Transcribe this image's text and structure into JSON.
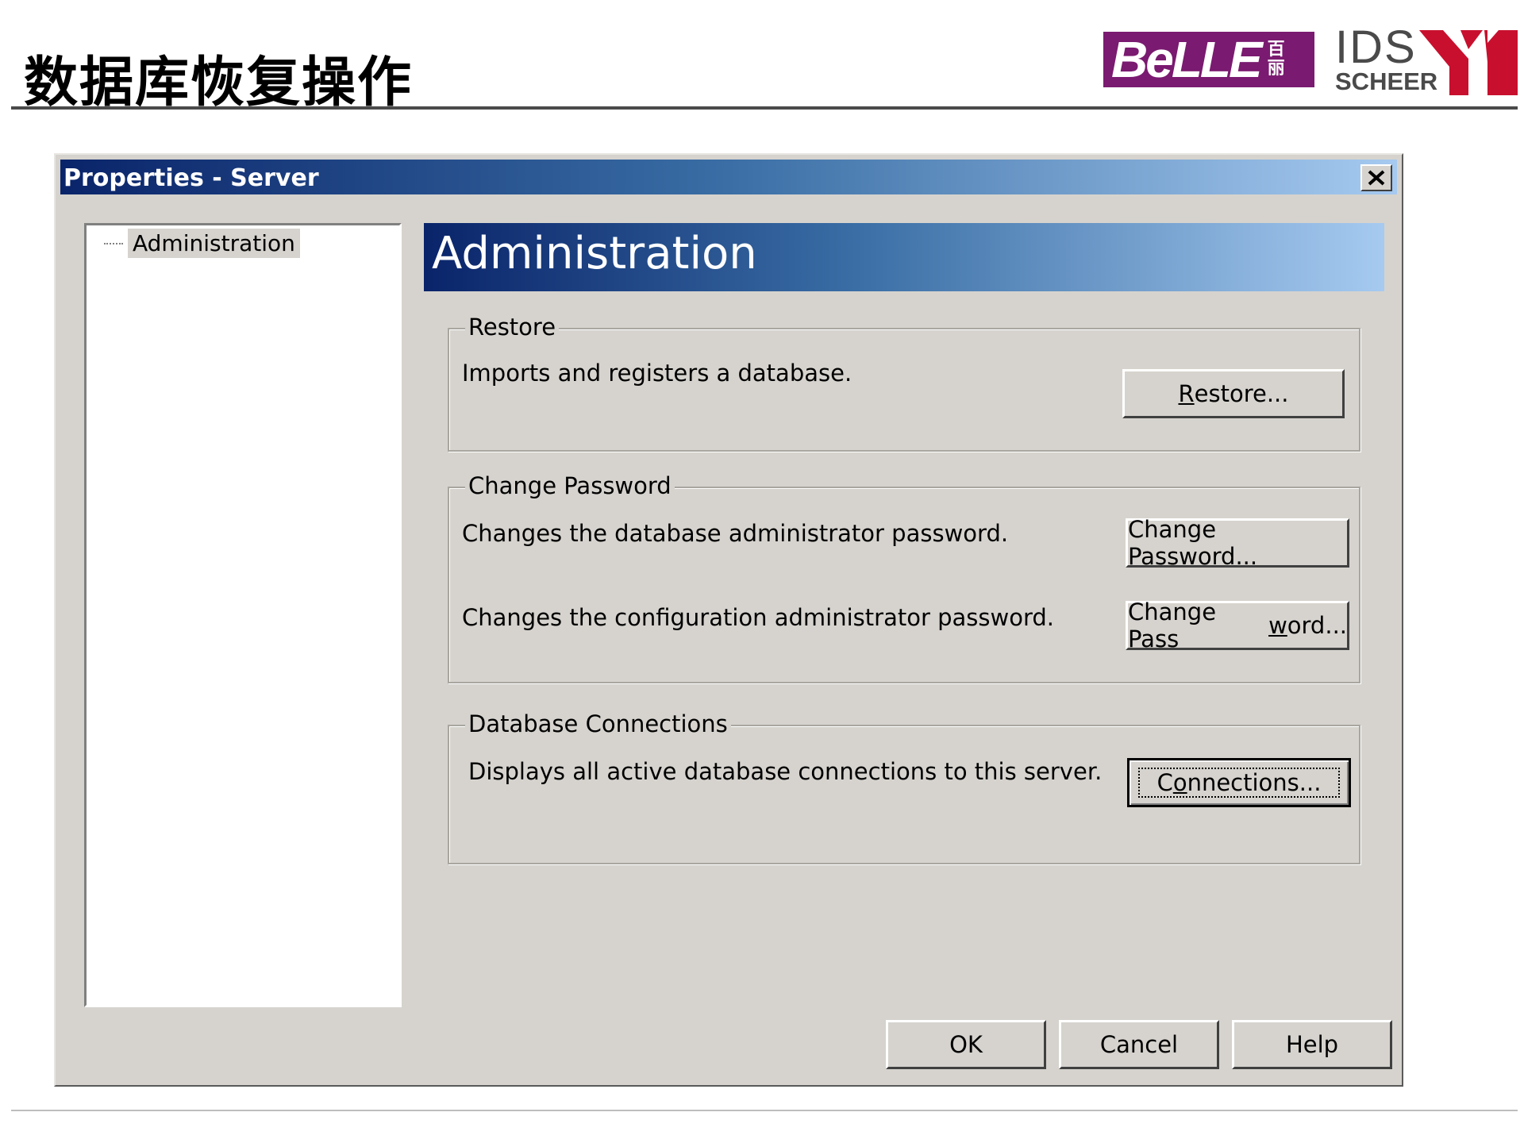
{
  "slide": {
    "title": "数据库恢复操作",
    "logo_belle_text": "BeLLE",
    "logo_belle_cn": "百丽",
    "logo_ids_text": "IDS",
    "logo_scheer_text": "SCHEER"
  },
  "dialog": {
    "title": "Properties - Server",
    "close_icon": "close-icon",
    "tree": {
      "items": [
        {
          "label": "Administration",
          "selected": true
        }
      ]
    },
    "panel_title": "Administration",
    "groups": {
      "restore": {
        "label": "Restore",
        "description": "Imports and registers a database.",
        "button_prefix": "",
        "button_mnemonic": "R",
        "button_suffix": "estore..."
      },
      "change_password": {
        "label": "Change Password",
        "rows": [
          {
            "description": "Changes the database administrator password.",
            "button_label": "Change Password..."
          },
          {
            "description": "Changes the configuration administrator password.",
            "button_prefix": "Change Pass",
            "button_mnemonic": "w",
            "button_suffix": "ord..."
          }
        ]
      },
      "connections": {
        "label": "Database Connections",
        "description": "Displays all active database connections to this server.",
        "button_prefix": "C",
        "button_mnemonic": "o",
        "button_suffix": "nnections..."
      }
    },
    "footer_buttons": {
      "ok": "OK",
      "cancel": "Cancel",
      "help": "Help"
    }
  },
  "colors": {
    "titlebar_start": "#0a246a",
    "titlebar_end": "#a6caf0",
    "dialog_face": "#d6d3ce",
    "brand_belle": "#7a1a70",
    "brand_ids_red": "#c8102e"
  }
}
